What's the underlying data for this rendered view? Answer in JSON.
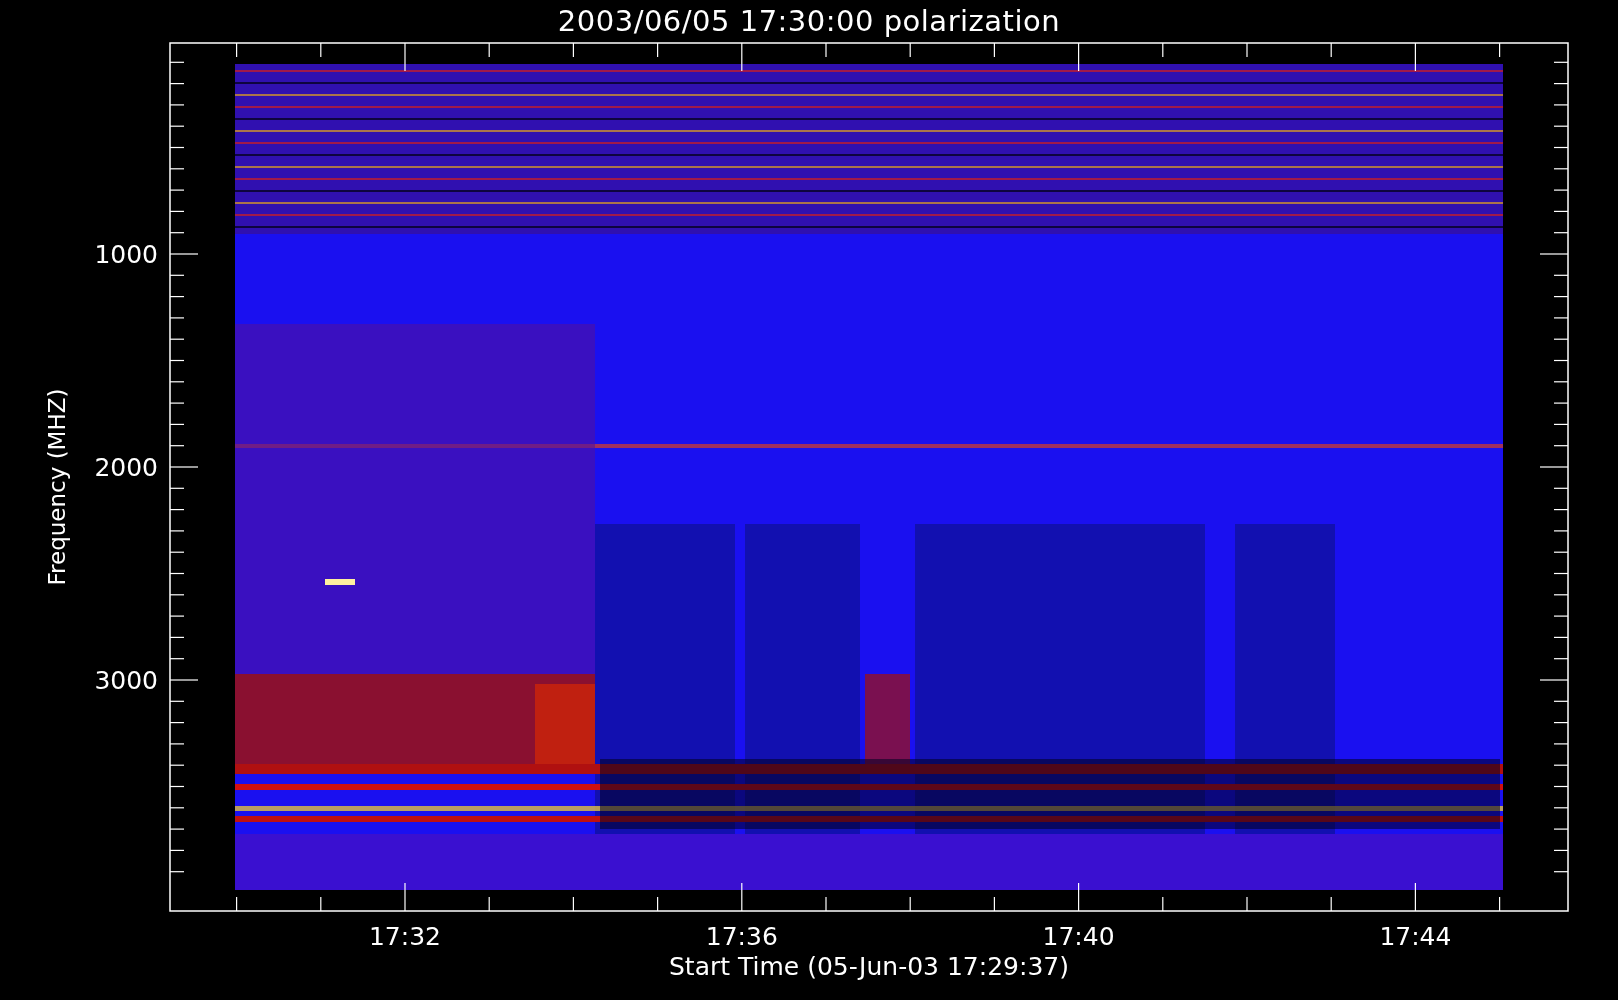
{
  "title": "2003/06/05 17:30:00 polarization",
  "y_axis": {
    "label": "Frequency (MHZ)",
    "ticks": [
      "1000",
      "2000",
      "3000"
    ]
  },
  "x_axis": {
    "label": "Start Time (05-Jun-03 17:29:37)",
    "ticks": [
      "17:32",
      "17:36",
      "17:40",
      "17:44"
    ]
  }
}
